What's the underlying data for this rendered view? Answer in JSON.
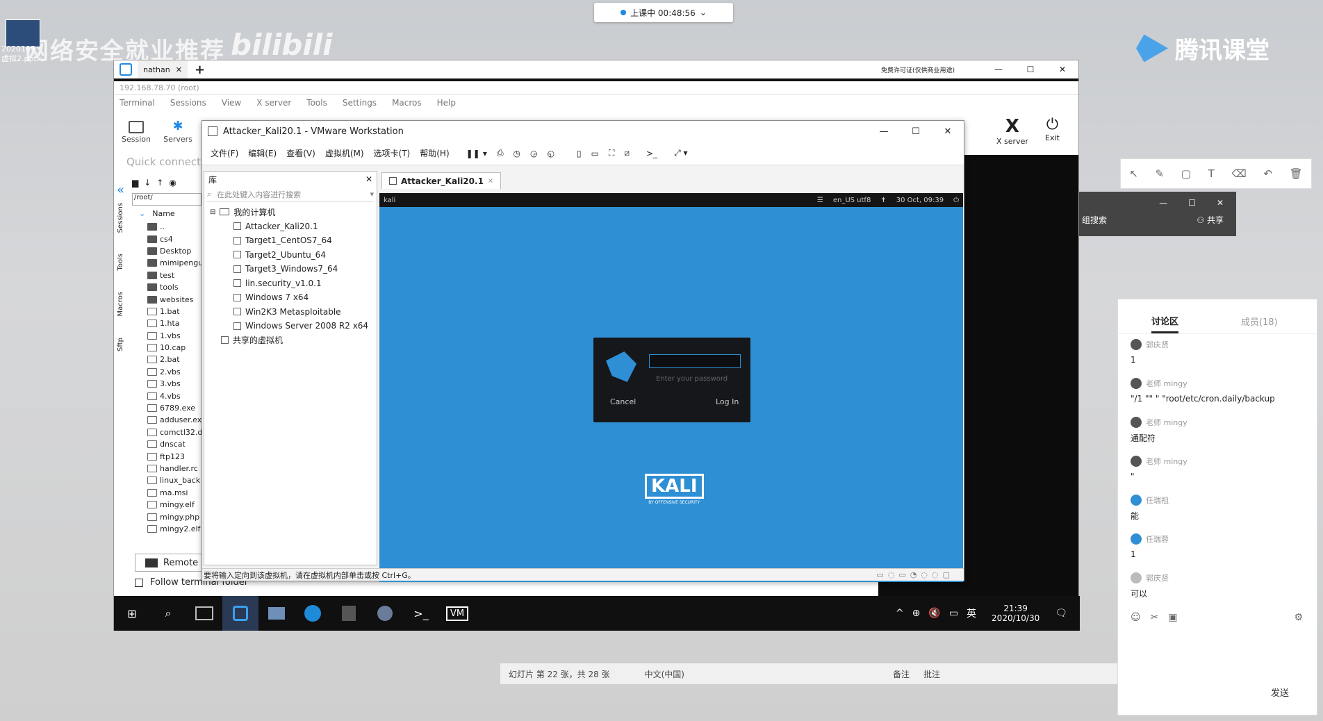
{
  "overlay": {
    "watermark_text": "网络安全就业推荐",
    "watermark_brand": "bilibili",
    "tencent_logo_text": "腾讯课堂",
    "desktop_icon_label_1": "2020105",
    "desktop_icon_label_2": "虚拟2.pptx",
    "live_status": "上课中 00:48:56"
  },
  "outer_window": {
    "tab_label": "nathan",
    "license_text": "免费许可证(仅供商业用途)",
    "mob_title": "192.168.78.70 (root)",
    "menu": [
      "Terminal",
      "Sessions",
      "View",
      "X server",
      "Tools",
      "Settings",
      "Macros",
      "Help"
    ],
    "toolbar": {
      "session": "Session",
      "servers": "Servers",
      "xserver": "X server",
      "exit": "Exit"
    },
    "quick_connect": "Quick connect...",
    "path": "/root/",
    "side_tabs": [
      "Sessions",
      "Tools",
      "Macros",
      "Sftp"
    ],
    "file_header": "Name",
    "files": [
      "..",
      "cs4",
      "Desktop",
      "mimipenguin",
      "test",
      "tools",
      "websites",
      "1.bat",
      "1.hta",
      "1.vbs",
      "10.cap",
      "2.bat",
      "2.vbs",
      "3.vbs",
      "4.vbs",
      "6789.exe",
      "adduser.exe",
      "comctl32.dll",
      "dnscat",
      "ftp123",
      "handler.rc",
      "linux_back",
      "ma.msi",
      "mingy.elf",
      "mingy.php",
      "mingy2.elf"
    ],
    "remote_label": "Remote",
    "follow_label": "Follow terminal folder"
  },
  "vmware": {
    "title": "Attacker_Kali20.1 - VMware Workstation",
    "menu": [
      "文件(F)",
      "编辑(E)",
      "查看(V)",
      "虚拟机(M)",
      "选项卡(T)",
      "帮助(H)"
    ],
    "library_title": "库",
    "search_placeholder": "在此处键入内容进行搜索",
    "root": "我的计算机",
    "vms": [
      "Attacker_Kali20.1",
      "Target1_CentOS7_64",
      "Target2_Ubuntu_64",
      "Target3_Windows7_64",
      "lin.security_v1.0.1",
      "Windows 7 x64",
      "Win2K3 Metasploitable",
      "Windows Server 2008 R2 x64"
    ],
    "shared": "共享的虚拟机",
    "tab": "Attacker_Kali20.1",
    "statusbar": "要将输入定向到该虚拟机，请在虚拟机内部单击或按 Ctrl+G。"
  },
  "guest": {
    "topbar_left": "kali",
    "locale": "en_US utf8",
    "datetime": "30 Oct, 09:39",
    "password_placeholder": "Enter your password",
    "cancel": "Cancel",
    "login": "Log In",
    "brand": "KALI",
    "brand_sub": "BY OFFENSIVE SECURITY"
  },
  "taskbar": {
    "time": "21:39",
    "date": "2020/10/30",
    "ime": "英"
  },
  "behind_ppt": {
    "slide_info": "幻灯片 第 22 张，共 28 张",
    "lang": "中文(中国)",
    "notes": "备注",
    "comments": "批注"
  },
  "side_panel": {
    "search_label": "组搜索",
    "share_label": "共享",
    "tab_discussion": "讨论区",
    "tab_members": "成员(18)",
    "messages": [
      {
        "name": "郭庆贤",
        "text": "1"
      },
      {
        "name": "老师 mingy",
        "text": "\"/1 \"\" \" \"root/etc/cron.daily/backup"
      },
      {
        "name": "老师 mingy",
        "text": "通配符"
      },
      {
        "name": "老师 mingy",
        "text": "\""
      },
      {
        "name": "任瑞祖",
        "text": "能"
      },
      {
        "name": "任瑞蓉",
        "text": "1"
      },
      {
        "name": "郭庆贤",
        "text": "可以"
      }
    ],
    "send": "发送"
  }
}
